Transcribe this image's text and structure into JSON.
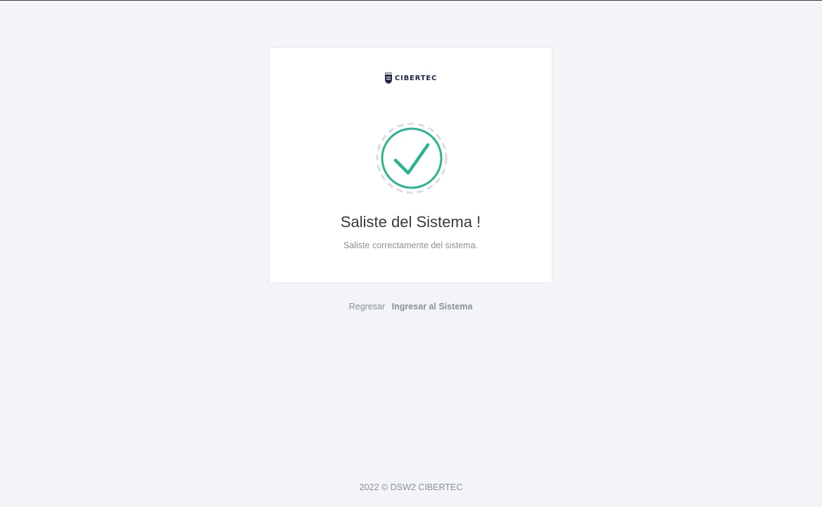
{
  "brand": {
    "logo_text": "CIBERTEC"
  },
  "card": {
    "title": "Saliste del Sistema !",
    "message": "Saliste correctamente del sistema."
  },
  "links": {
    "back_label": "Regresar",
    "signin_label": "Ingresar al Sistema"
  },
  "footer": {
    "text": "2022 © DSW2 CIBERTEC"
  },
  "colors": {
    "success": "#2ab591",
    "background": "#f3f4f7",
    "brand": "#1f2a4a"
  },
  "icons": {
    "status": "check-circle-icon",
    "logo": "shield-icon"
  }
}
